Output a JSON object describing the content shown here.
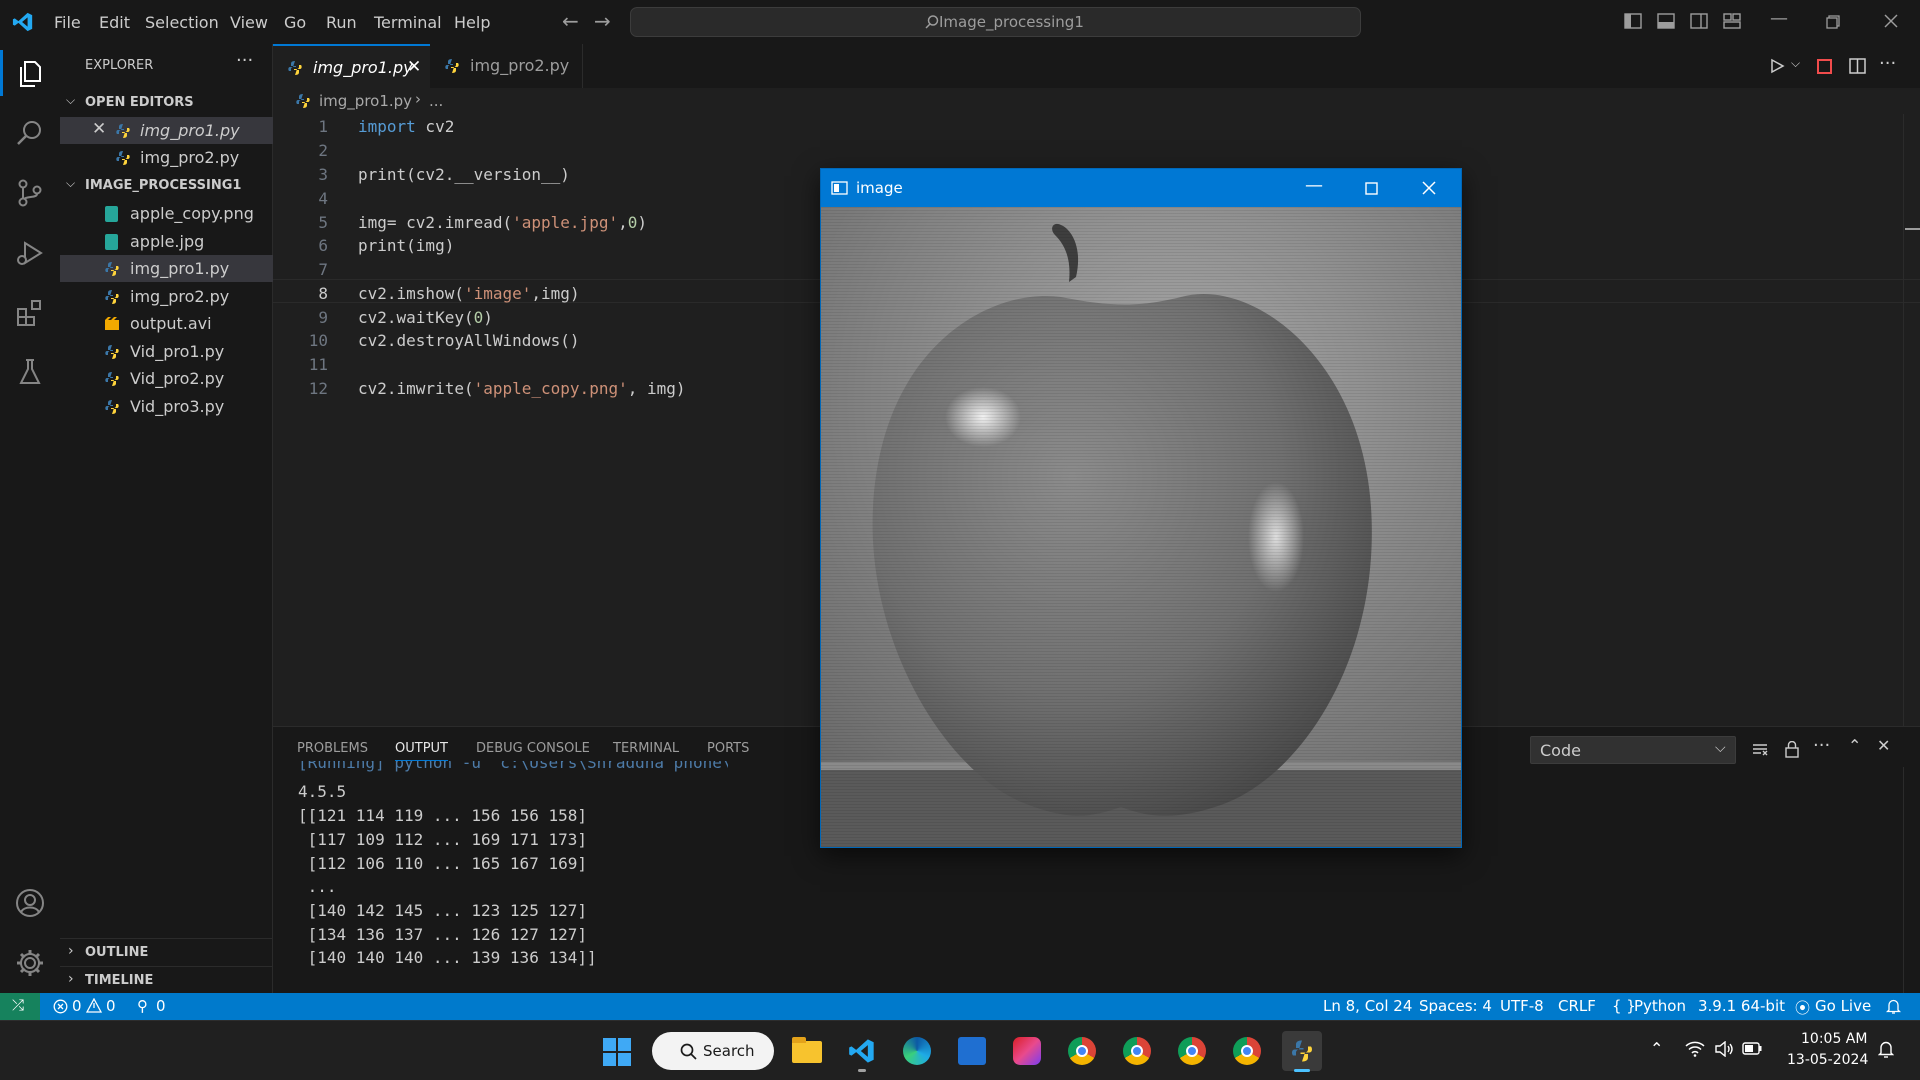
{
  "menu": [
    "File",
    "Edit",
    "Selection",
    "View",
    "Go",
    "Run",
    "Terminal",
    "Help"
  ],
  "search": {
    "text": "Image_processing1"
  },
  "explorer": {
    "title": "EXPLORER",
    "open_editors_label": "OPEN EDITORS",
    "open_editors": [
      "img_pro1.py",
      "img_pro2.py"
    ],
    "folder_label": "IMAGE_PROCESSING1",
    "files": [
      "apple_copy.png",
      "apple.jpg",
      "img_pro1.py",
      "img_pro2.py",
      "output.avi",
      "Vid_pro1.py",
      "Vid_pro2.py",
      "Vid_pro3.py"
    ],
    "outline_label": "OUTLINE",
    "timeline_label": "TIMELINE"
  },
  "tabs": [
    {
      "label": "img_pro1.py",
      "active": true
    },
    {
      "label": "img_pro2.py",
      "active": false
    }
  ],
  "breadcrumb": {
    "file": "img_pro1.py",
    "rest": "..."
  },
  "code_lines": [
    "import cv2",
    "",
    "print(cv2.__version__)",
    "",
    "img= cv2.imread('apple.jpg',0)",
    "print(img)",
    "",
    "cv2.imshow('image',img)",
    "cv2.waitKey(0)",
    "cv2.destroyAllWindows()",
    "",
    "cv2.imwrite('apple_copy.png', img)"
  ],
  "line_numbers": [
    "1",
    "2",
    "3",
    "4",
    "5",
    "6",
    "7",
    "8",
    "9",
    "10",
    "11",
    "12"
  ],
  "panel": {
    "tabs": [
      "PROBLEMS",
      "OUTPUT",
      "DEBUG CONSOLE",
      "TERMINAL",
      "PORTS"
    ],
    "active_tab": "OUTPUT",
    "dropdown_value": "Code",
    "output_lines": [
      "4.5.5",
      "[[121 114 119 ... 156 156 158]",
      " [117 109 112 ... 169 171 173]",
      " [112 106 110 ... 165 167 169]",
      " ...",
      " [140 142 145 ... 123 125 127]",
      " [134 136 137 ... 126 127 127]",
      " [140 140 140 ... 139 136 134]]"
    ],
    "partial_line": "[Running] python -u \"c:\\Users\\Shraddha phone\\Image_processi"
  },
  "statusbar": {
    "errors": "0",
    "warnings": "0",
    "ports": "0",
    "position": "Ln 8, Col 24",
    "spaces": "Spaces: 4",
    "encoding": "UTF-8",
    "eol": "CRLF",
    "language": "Python",
    "interpreter": "3.9.1 64-bit",
    "golive": "Go Live"
  },
  "image_window": {
    "title": "image"
  },
  "taskbar": {
    "search_label": "Search",
    "time": "10:05 AM",
    "date": "13-05-2024"
  },
  "colors": {
    "accent": "#007acc",
    "window_title": "#0078d4"
  }
}
